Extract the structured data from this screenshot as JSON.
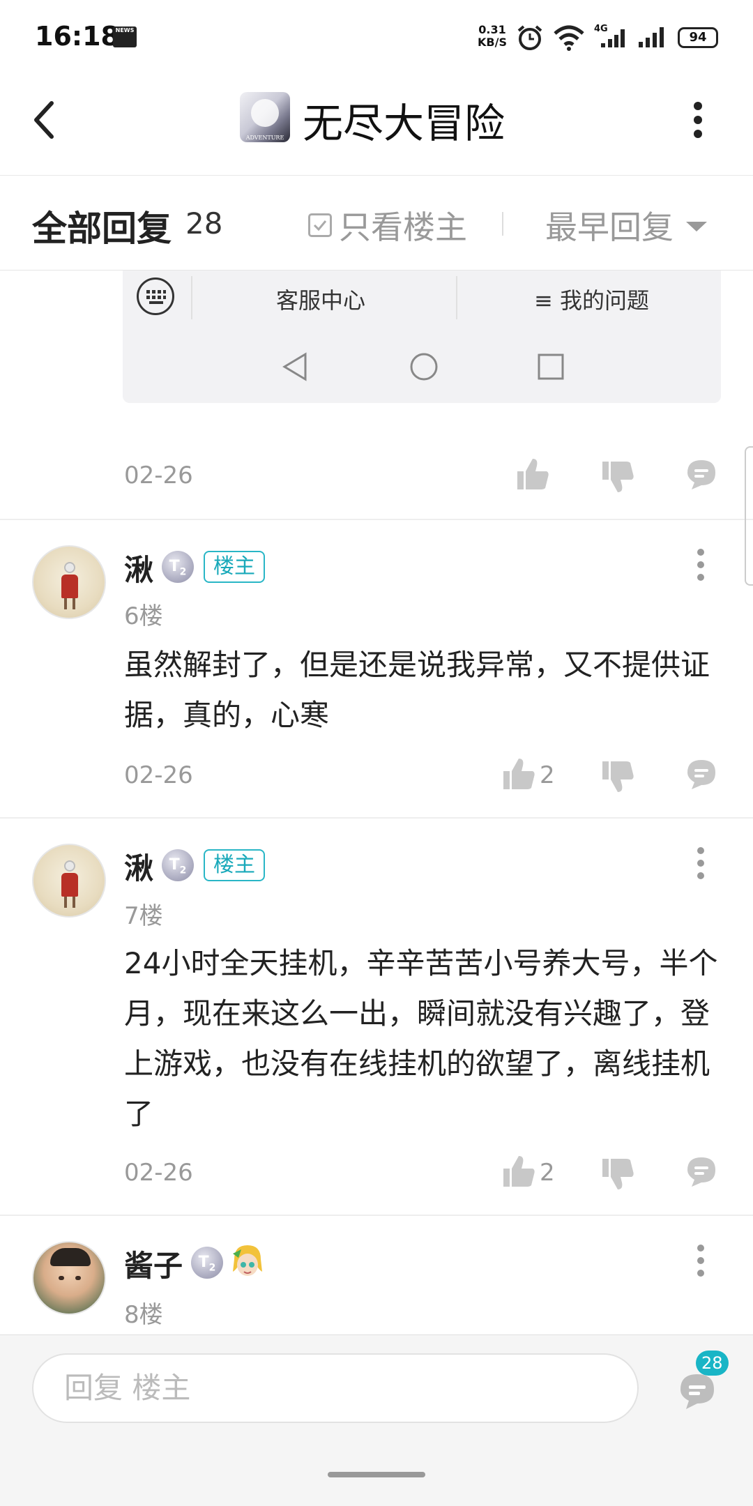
{
  "status_bar": {
    "time": "16:18",
    "news_label": "NEWS",
    "net_speed_value": "0.31",
    "net_speed_unit": "KB/S",
    "network_type": "4G",
    "battery": "94"
  },
  "header": {
    "title": "无尽大冒险",
    "icon_caption": "ADVENTURE"
  },
  "filter_bar": {
    "all_replies_label": "全部回复",
    "reply_count": "28",
    "only_op_label": "只看楼主",
    "sort_label": "最早回复"
  },
  "embedded_image": {
    "customer_service": "客服中心",
    "my_questions": "≡ 我的问题"
  },
  "posts": [
    {
      "date": "02-26",
      "likes": ""
    },
    {
      "username": "湫",
      "level": "T",
      "level_sub": "2",
      "op_badge": "楼主",
      "floor": "6楼",
      "content": "虽然解封了，但是还是说我异常，又不提供证据，真的，心寒",
      "date": "02-26",
      "likes": "2"
    },
    {
      "username": "湫",
      "level": "T",
      "level_sub": "2",
      "op_badge": "楼主",
      "floor": "7楼",
      "content": "24小时全天挂机，辛辛苦苦小号养大号，半个月，现在来这么一出，瞬间就没有兴趣了，登上游戏，也没有在线挂机的欲望了，离线挂机了",
      "date": "02-26",
      "likes": "2"
    },
    {
      "username": "酱子",
      "level": "T",
      "level_sub": "2",
      "floor": "8楼"
    }
  ],
  "bottom_bar": {
    "reply_placeholder": "回复  楼主",
    "comment_count": "28"
  },
  "colors": {
    "accent": "#19b5c6",
    "muted_text": "#999999",
    "icon_gray": "#c8c8c8"
  }
}
